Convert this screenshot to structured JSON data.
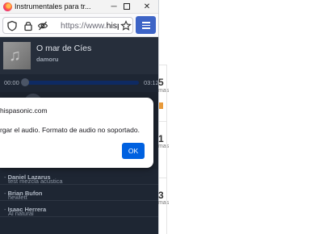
{
  "window": {
    "tab_title": "Instrumentales para tr...",
    "min_label": "─",
    "close_label": "✕"
  },
  "urlbar": {
    "url_prefix": "https://www.",
    "url_domain": "hisp"
  },
  "player": {
    "track_title": "O mar de Cíes",
    "track_artist": "damoru",
    "time_current": "00:00",
    "time_total": "03:12",
    "progress": 0.0
  },
  "alert": {
    "origin": "hispasonic.com",
    "message": "rgar el audio. Formato de audio no soportado.",
    "ok_label": "OK"
  },
  "tracks": [
    {
      "title": "test mezcla acústica",
      "sep": " - ",
      "artist": "Daniel Lazarus"
    },
    {
      "title": "hewlett",
      "sep": " - ",
      "artist": "Brian Bufon"
    },
    {
      "title": "Al natural",
      "sep": " - ",
      "artist": "Isaac Herrera"
    }
  ],
  "side_page": {
    "num_1": "5",
    "unit_1": "mas",
    "num_2": "1",
    "unit_2": "mas",
    "num_3": "3",
    "unit_3": "mas"
  },
  "colors": {
    "accent": "#0061e0",
    "player_bg": "#262e3b",
    "progress": "#2f6cde"
  },
  "icons": [
    "firefox-icon",
    "shield-icon",
    "lock-icon",
    "tracking-protection-icon",
    "star-icon",
    "hamburger-menu-icon"
  ]
}
